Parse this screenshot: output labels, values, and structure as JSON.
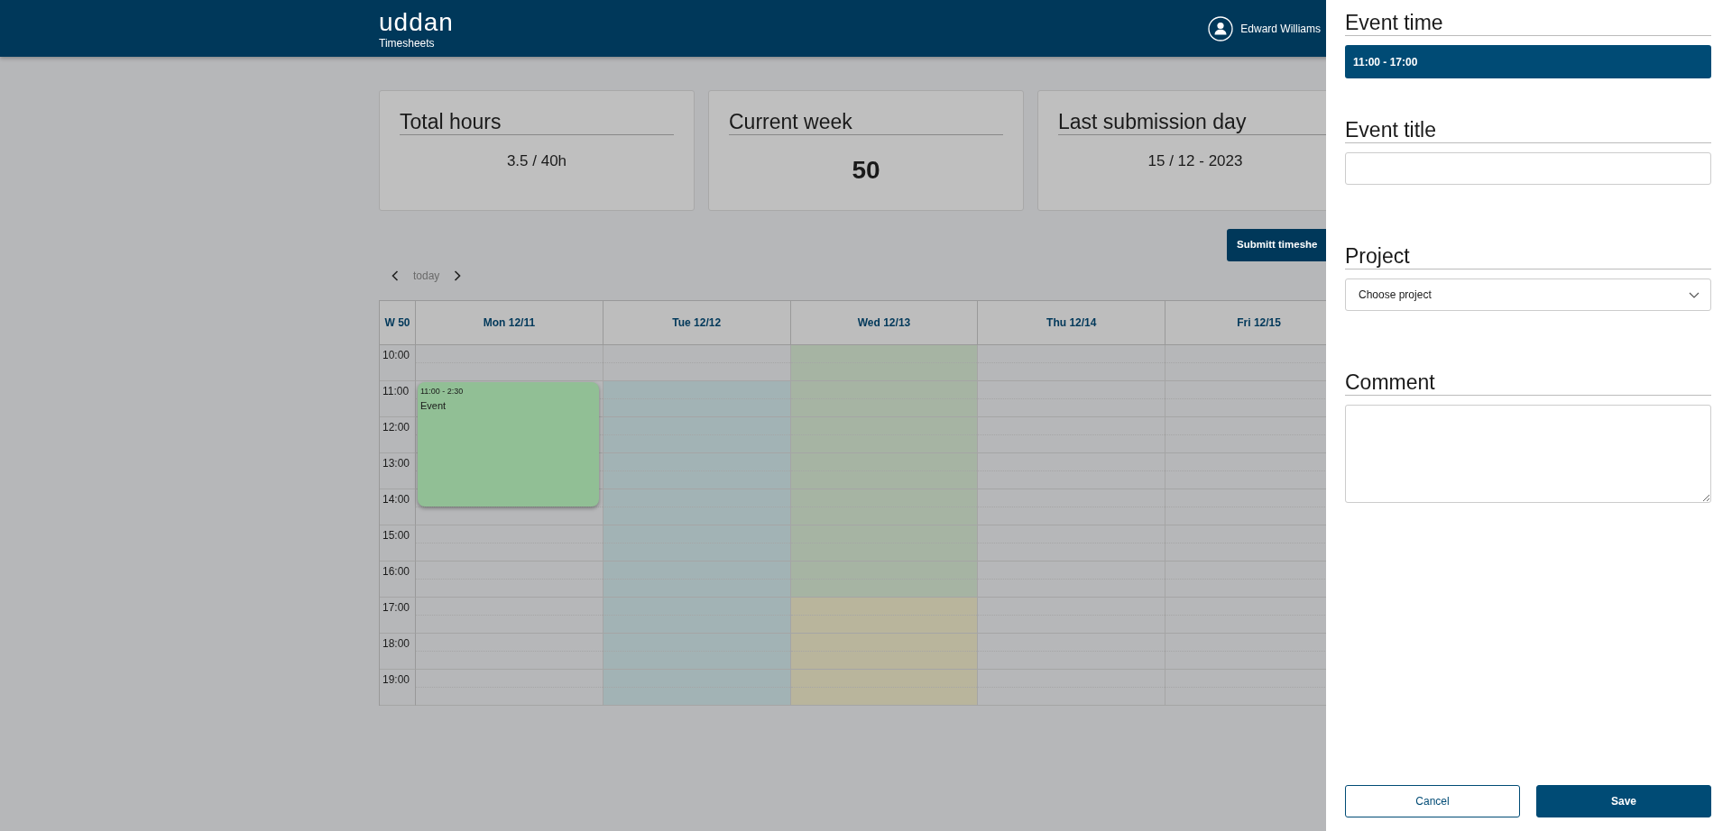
{
  "header": {
    "logo": "uddan",
    "app_name": "Timesheets",
    "user": "Edward Williams"
  },
  "stats": [
    {
      "title": "Total hours",
      "value": "3.5 / 40h",
      "kind": "plain"
    },
    {
      "title": "Current week",
      "value": "50",
      "kind": "large"
    },
    {
      "title": "Last submission day",
      "value": "15 / 12 - 2023",
      "kind": "plain"
    }
  ],
  "submit_button": "Submitt timeshe",
  "calendar": {
    "today": "today",
    "week_label": "W 50",
    "hours": [
      "10:00",
      "11:00",
      "12:00",
      "13:00",
      "14:00",
      "15:00",
      "16:00",
      "17:00",
      "18:00",
      "19:00"
    ],
    "days": [
      {
        "label": "Mon 12/11",
        "events": [
          {
            "time": "11:00 - 2:30",
            "title": "Event",
            "color": "#91bf95"
          }
        ]
      },
      {
        "label": "Tue 12/12",
        "cells": [
          {
            "color": "#b6b7b9"
          },
          {
            "color": "#a2b3b5"
          },
          {
            "color": "#a2b3b5"
          },
          {
            "color": "#a2b3b5"
          },
          {
            "color": "#a2b3b5"
          },
          {
            "color": "#a2b3b5"
          },
          {
            "color": "#a2b3b5"
          },
          {
            "color": "#a2b3b5"
          },
          {
            "color": "#a2b3b5"
          },
          {
            "color": "#a2b3b5"
          }
        ]
      },
      {
        "label": "Wed 12/13",
        "cells": [
          {
            "color": "#a6b4a3"
          },
          {
            "color": "#a6b4a3"
          },
          {
            "color": "#a6b4a3"
          },
          {
            "color": "#a6b4a3"
          },
          {
            "color": "#a6b4a3"
          },
          {
            "color": "#a6b4a3"
          },
          {
            "color": "#a6b4a3"
          },
          {
            "color": "#b9b59c"
          },
          {
            "color": "#b9b59c"
          },
          {
            "color": "#b9b59c"
          }
        ]
      },
      {
        "label": "Thu 12/14"
      },
      {
        "label": "Fri 12/15"
      }
    ]
  },
  "panel": {
    "fields": [
      {
        "kind": "time",
        "label": "Event time",
        "value": "11:00 - 17:00"
      },
      {
        "kind": "text",
        "label": "Event title"
      },
      {
        "kind": "select",
        "label": "Project",
        "placeholder": "Choose project"
      },
      {
        "kind": "textarea",
        "label": "Comment"
      }
    ],
    "buttons": [
      {
        "label": "Cancel",
        "kind": "secondary"
      },
      {
        "label": "Save",
        "kind": "primary"
      }
    ]
  }
}
